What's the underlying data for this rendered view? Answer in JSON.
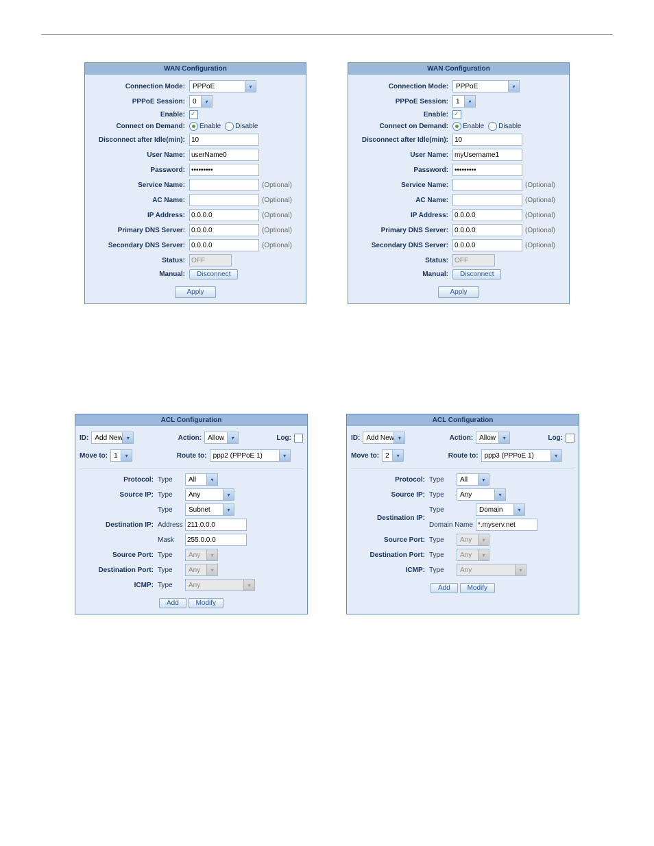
{
  "wan_title": "WAN Configuration",
  "acl_title": "ACL Configuration",
  "labels": {
    "conn_mode": "Connection Mode:",
    "pppoe_session": "PPPoE Session:",
    "enable": "Enable:",
    "cod": "Connect on Demand:",
    "idle": "Disconnect after Idle(min):",
    "user": "User Name:",
    "pass": "Password:",
    "svc": "Service Name:",
    "ac": "AC Name:",
    "ip": "IP Address:",
    "pdns": "Primary DNS Server:",
    "sdns": "Secondary DNS Server:",
    "status": "Status:",
    "manual": "Manual:",
    "optional": "(Optional)",
    "enable_r": "Enable",
    "disable_r": "Disable",
    "apply": "Apply",
    "disconnect": "Disconnect",
    "id": "ID:",
    "action": "Action:",
    "log": "Log:",
    "moveto": "Move to:",
    "routeto": "Route to:",
    "protocol": "Protocol:",
    "srcip": "Source IP:",
    "dstip": "Destination IP:",
    "srcport": "Source Port:",
    "dstport": "Destination Port:",
    "icmp": "ICMP:",
    "type": "Type",
    "address": "Address",
    "mask": "Mask",
    "domainname": "Domain Name",
    "add": "Add",
    "modify": "Modify"
  },
  "wan": [
    {
      "mode": "PPPoE",
      "session": "0",
      "idle": "10",
      "user": "userName0",
      "pass": "•••••••••",
      "ip": "0.0.0.0",
      "pdns": "0.0.0.0",
      "sdns": "0.0.0.0",
      "status": "OFF"
    },
    {
      "mode": "PPPoE",
      "session": "1",
      "idle": "10",
      "user": "myUsername1",
      "pass": "•••••••••",
      "ip": "0.0.0.0",
      "pdns": "0.0.0.0",
      "sdns": "0.0.0.0",
      "status": "OFF"
    }
  ],
  "acl": [
    {
      "id": "Add New",
      "action": "Allow",
      "moveto": "1",
      "routeto": "ppp2 (PPPoE 1)",
      "protocol": "All",
      "srcip_type": "Any",
      "dst_type": "Subnet",
      "dst_addr": "211.0.0.0",
      "dst_mask": "255.0.0.0",
      "srcport": "Any",
      "dstport": "Any",
      "icmp": "Any"
    },
    {
      "id": "Add New",
      "action": "Allow",
      "moveto": "2",
      "routeto": "ppp3 (PPPoE 1)",
      "protocol": "All",
      "srcip_type": "Any",
      "dst_type": "Domain",
      "dst_domain": "*.myserv.net",
      "srcport": "Any",
      "dstport": "Any",
      "icmp": "Any"
    }
  ]
}
